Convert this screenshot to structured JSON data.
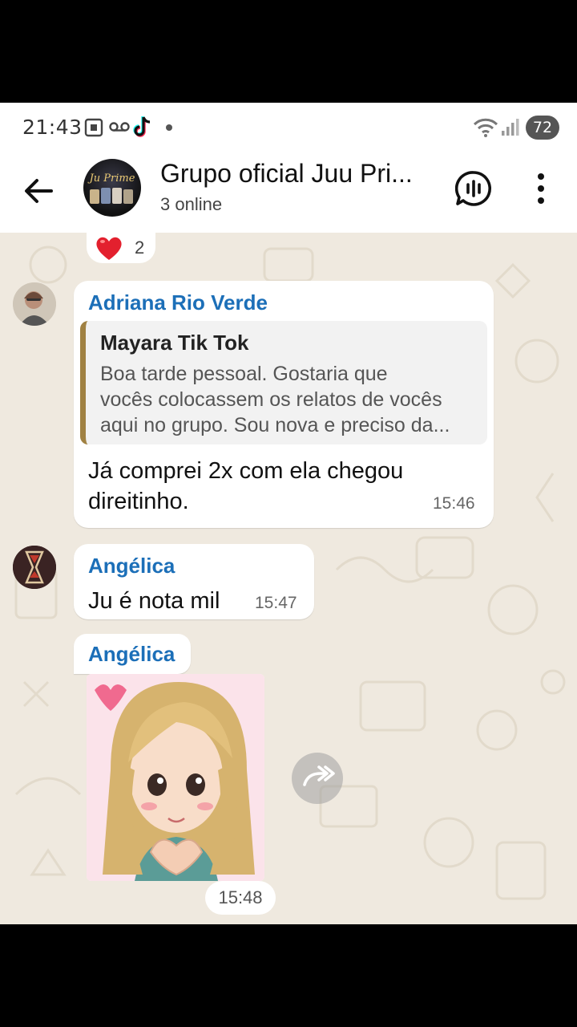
{
  "status_bar": {
    "time": "21:43",
    "battery": "72",
    "icons": [
      "screenshot-icon",
      "voicemail-icon",
      "tiktok-icon",
      "dot-icon",
      "wifi-icon",
      "signal-icon"
    ]
  },
  "header": {
    "title": "Grupo oficial Juu Pri...",
    "subtitle": "3 online",
    "avatar_text": "Ju Prime",
    "icons": [
      "back-arrow-icon",
      "voice-chat-icon",
      "more-vert-icon"
    ]
  },
  "chat": {
    "reaction": {
      "emoji": "heart",
      "count": "2"
    },
    "messages": [
      {
        "sender": "Adriana Rio Verde",
        "quote": {
          "author": "Mayara Tik Tok",
          "lines": [
            "Boa tarde pessoal. Gostaria que",
            "vocês colocassem os relatos de vocês",
            "aqui no grupo. Sou nova e preciso da..."
          ]
        },
        "lines": [
          "Já comprei 2x com ela chegou",
          "direitinho."
        ],
        "time": "15:46"
      },
      {
        "sender": "Angélica",
        "text": "Ju é nota mil",
        "time": "15:47"
      },
      {
        "sender": "Angélica",
        "image": "sticker-girl-heart",
        "time": "15:48"
      }
    ]
  },
  "colors": {
    "sender_name": "#1c6fb8",
    "quote_bar": "#a08142",
    "chat_background": "#efe9df"
  }
}
